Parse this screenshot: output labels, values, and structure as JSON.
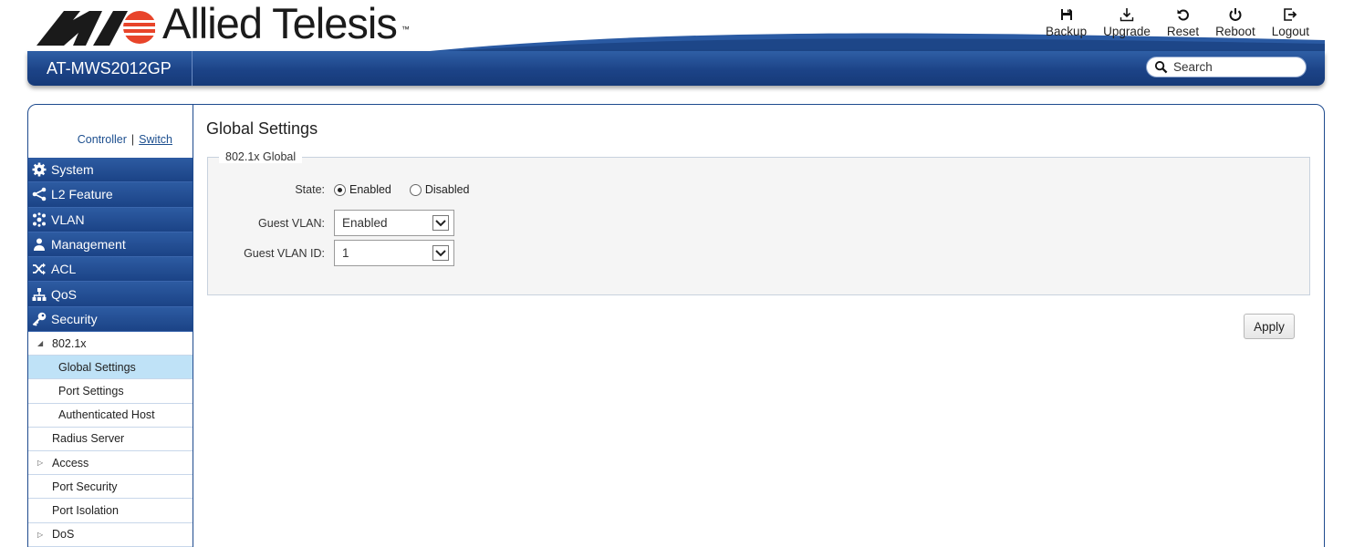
{
  "brand": {
    "name": "Allied Telesis",
    "tm": "™"
  },
  "toolbar": [
    {
      "label": "Backup",
      "icon": "floppy-icon"
    },
    {
      "label": "Upgrade",
      "icon": "download-icon"
    },
    {
      "label": "Reset",
      "icon": "reset-icon"
    },
    {
      "label": "Reboot",
      "icon": "power-icon"
    },
    {
      "label": "Logout",
      "icon": "logout-icon"
    }
  ],
  "model": "AT-MWS2012GP",
  "search": {
    "placeholder": "Search",
    "value": ""
  },
  "mode": {
    "controller": "Controller",
    "separator": "|",
    "switch": "Switch",
    "active": "Switch"
  },
  "menu": [
    {
      "label": "System",
      "icon": "gear-icon"
    },
    {
      "label": "L2 Feature",
      "icon": "share-icon"
    },
    {
      "label": "VLAN",
      "icon": "network-icon"
    },
    {
      "label": "Management",
      "icon": "user-icon"
    },
    {
      "label": "ACL",
      "icon": "shuffle-icon"
    },
    {
      "label": "QoS",
      "icon": "qos-icon"
    },
    {
      "label": "Security",
      "icon": "key-icon"
    }
  ],
  "security_sub": [
    {
      "label": "802.1x",
      "arrow": "◢",
      "expanded": true
    },
    {
      "label": "Global Settings",
      "level": 2,
      "selected": true
    },
    {
      "label": "Port Settings",
      "level": 2
    },
    {
      "label": "Authenticated Host",
      "level": 2
    },
    {
      "label": "Radius Server"
    },
    {
      "label": "Access",
      "arrow": "▷"
    },
    {
      "label": "Port Security"
    },
    {
      "label": "Port Isolation"
    },
    {
      "label": "DoS",
      "arrow": "▷"
    }
  ],
  "page": {
    "title": "Global Settings",
    "group_title": "802.1x Global",
    "state_label": "State:",
    "state_options": [
      "Enabled",
      "Disabled"
    ],
    "state_value": "Enabled",
    "guest_vlan_label": "Guest VLAN:",
    "guest_vlan_value": "Enabled",
    "guest_vlan_id_label": "Guest VLAN ID:",
    "guest_vlan_id_value": "1",
    "apply_label": "Apply"
  },
  "colors": {
    "nav_blue": "#1c4387",
    "selected_bg": "#bfe2f7",
    "logo_red": "#e8442a"
  }
}
